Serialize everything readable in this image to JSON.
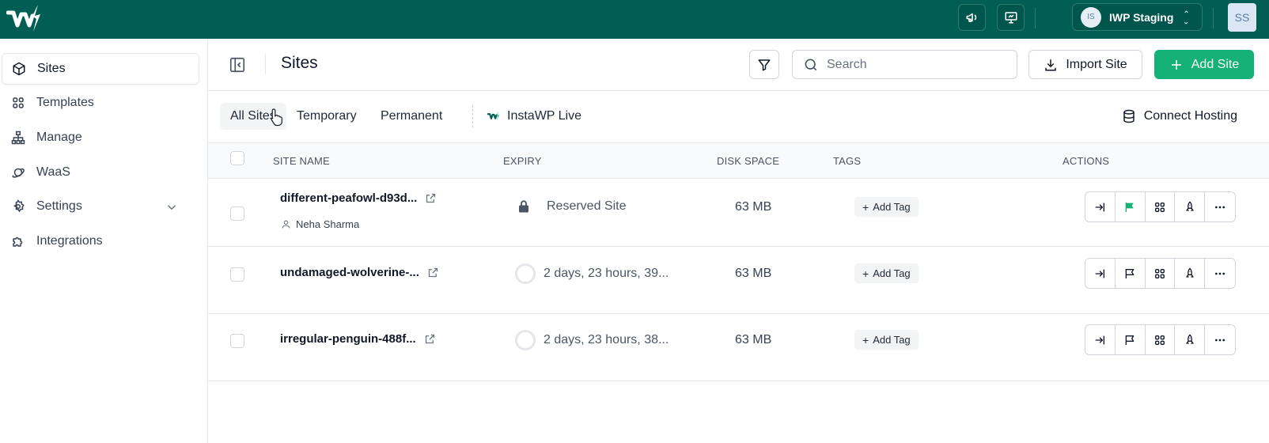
{
  "topbar": {
    "workspace_initials": "IS",
    "workspace_name": "IWP Staging",
    "user_initials": "SS"
  },
  "sidebar": {
    "items": [
      {
        "label": "Sites",
        "icon": "cube-icon"
      },
      {
        "label": "Templates",
        "icon": "grid-icon"
      },
      {
        "label": "Manage",
        "icon": "sitemap-icon"
      },
      {
        "label": "WaaS",
        "icon": "planet-icon"
      },
      {
        "label": "Settings",
        "icon": "gear-icon"
      },
      {
        "label": "Integrations",
        "icon": "puzzle-icon"
      }
    ]
  },
  "header": {
    "title": "Sites",
    "search_placeholder": "Search",
    "import_label": "Import Site",
    "add_label": "Add Site"
  },
  "tabs": {
    "all": "All Sites",
    "temporary": "Temporary",
    "permanent": "Permanent",
    "live": "InstaWP Live",
    "connect_hosting": "Connect Hosting"
  },
  "table": {
    "headers": {
      "site_name": "SITE NAME",
      "expiry": "EXPIRY",
      "disk_space": "DISK SPACE",
      "tags": "TAGS",
      "actions": "ACTIONS"
    },
    "rows": [
      {
        "site_name": "different-peafowl-d93d...",
        "owner": "Neha Sharma",
        "expiry": "Reserved Site",
        "reserved": true,
        "disk_space": "63 MB",
        "tag_label": "Add Tag"
      },
      {
        "site_name": "undamaged-wolverine-...",
        "owner": "",
        "expiry": "2 days, 23 hours, 39...",
        "reserved": false,
        "disk_space": "63 MB",
        "tag_label": "Add Tag"
      },
      {
        "site_name": "irregular-penguin-488f...",
        "owner": "",
        "expiry": "2 days, 23 hours, 38...",
        "reserved": false,
        "disk_space": "63 MB",
        "tag_label": "Add Tag"
      }
    ]
  },
  "colors": {
    "topbar": "#005e54",
    "accent": "#16b176",
    "reserved_flag": "#16b176"
  }
}
